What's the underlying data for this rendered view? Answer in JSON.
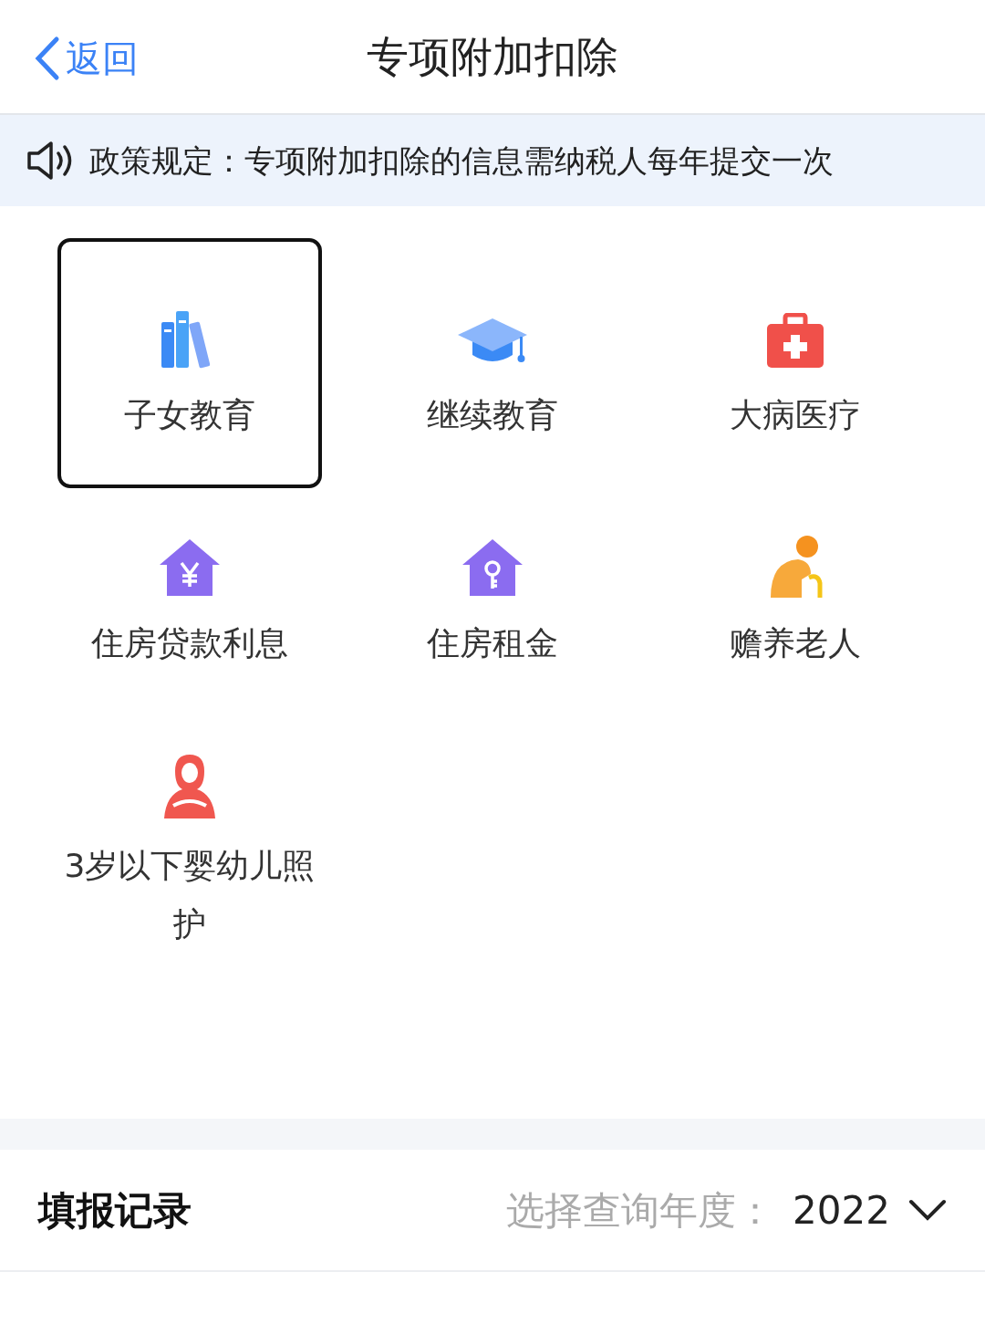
{
  "header": {
    "back": "返回",
    "title": "专项附加扣除"
  },
  "notice": {
    "text": "政策规定：专项附加扣除的信息需纳税人每年提交一次"
  },
  "items": [
    {
      "label": "子女教育",
      "kind": "books",
      "selected": true
    },
    {
      "label": "继续教育",
      "kind": "cap",
      "selected": false
    },
    {
      "label": "大病医疗",
      "kind": "medkit",
      "selected": false
    },
    {
      "label": "住房贷款利息",
      "kind": "house-yuan",
      "selected": false
    },
    {
      "label": "住房租金",
      "kind": "house-key",
      "selected": false
    },
    {
      "label": "赡养老人",
      "kind": "elder",
      "selected": false
    },
    {
      "label": "3岁以下婴幼儿照护",
      "kind": "mother",
      "selected": false
    }
  ],
  "records": {
    "title": "填报记录",
    "year_label": "选择查询年度：",
    "year": "2022"
  }
}
